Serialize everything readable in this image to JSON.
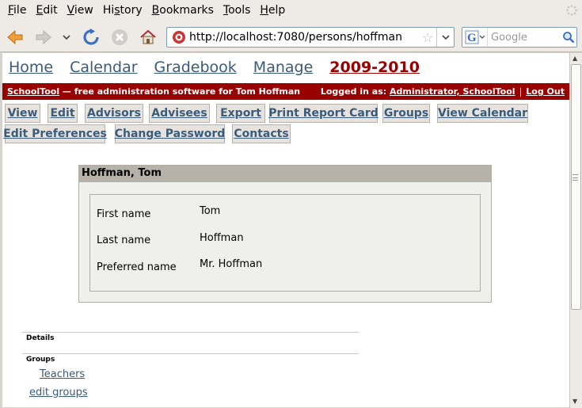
{
  "menu": [
    "File",
    "Edit",
    "View",
    "History",
    "Bookmarks",
    "Tools",
    "Help"
  ],
  "menu_underline": [
    "F",
    "E",
    "V",
    "s",
    "B",
    "T",
    "H"
  ],
  "toolbar": {
    "url": "http://localhost:7080/persons/hoffman",
    "search_placeholder": "Google"
  },
  "nav": {
    "links": [
      "Home",
      "Calendar",
      "Gradebook",
      "Manage"
    ],
    "year": "2009-2010"
  },
  "banner": {
    "app_name": "SchoolTool",
    "tagline": " — free administration software for Tom Hoffman",
    "logged_in_prefix": "Logged in as: ",
    "user": "Administrator, SchoolTool",
    "sep": "|",
    "logout": "Log Out"
  },
  "actions": [
    "View",
    "Edit",
    "Advisors",
    "Advisees",
    "Export",
    "Print Report Card",
    "Groups",
    "View Calendar",
    "Edit Preferences",
    "Change Password",
    "Contacts"
  ],
  "person": {
    "header": "Hoffman, Tom",
    "fields": [
      {
        "label": "First name",
        "value": "Tom"
      },
      {
        "label": "Last name",
        "value": "Hoffman"
      },
      {
        "label": "Preferred name",
        "value": "Mr. Hoffman"
      }
    ]
  },
  "details": {
    "details_label": "Details",
    "groups_label": "Groups",
    "groups": [
      "Teachers"
    ],
    "edit_groups": "edit groups"
  },
  "colors": {
    "link": "#3a5b7b",
    "banner": "#990000",
    "year": "#990000"
  }
}
